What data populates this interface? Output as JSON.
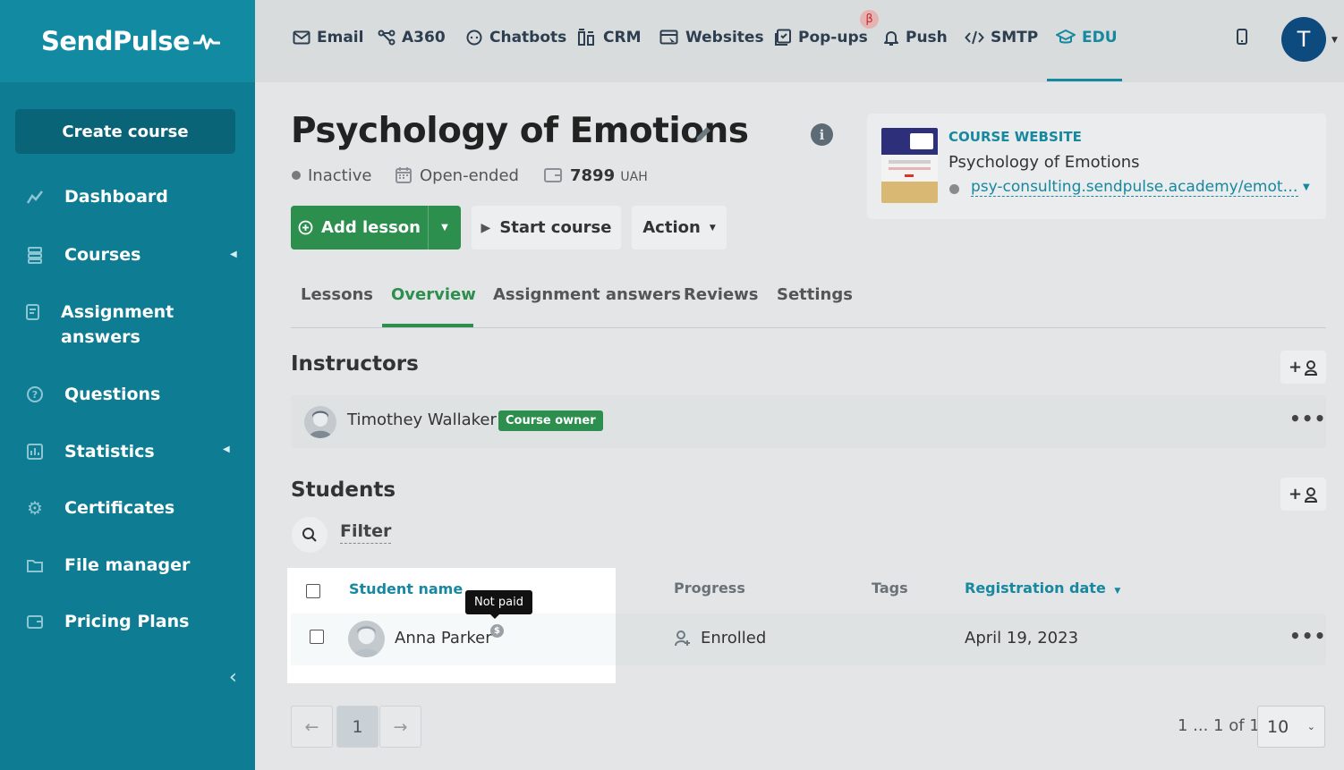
{
  "brand": "SendPulse",
  "sidebar": {
    "create_label": "Create course",
    "items": [
      {
        "label": "Dashboard",
        "icon": "chart-line-icon"
      },
      {
        "label": "Courses",
        "icon": "stack-icon"
      },
      {
        "label": "Assignment answers",
        "icon": "assignment-icon"
      },
      {
        "label": "Questions",
        "icon": "question-icon"
      },
      {
        "label": "Statistics",
        "icon": "statistics-icon"
      },
      {
        "label": "Certificates",
        "icon": "gear-icon"
      },
      {
        "label": "File manager",
        "icon": "folder-icon"
      },
      {
        "label": "Pricing Plans",
        "icon": "wallet-icon"
      }
    ]
  },
  "topnav": {
    "items": [
      {
        "label": "Email"
      },
      {
        "label": "A360"
      },
      {
        "label": "Chatbots"
      },
      {
        "label": "CRM"
      },
      {
        "label": "Websites"
      },
      {
        "label": "Pop-ups"
      },
      {
        "label": "Push"
      },
      {
        "label": "SMTP"
      },
      {
        "label": "EDU"
      }
    ],
    "beta": "β",
    "user_initial": "T"
  },
  "course": {
    "title": "Psychology of Emotions",
    "status": "Inactive",
    "duration": "Open-ended",
    "price": "7899",
    "currency": "UAH"
  },
  "actions": {
    "add_lesson": "Add lesson",
    "start_course": "Start course",
    "action": "Action"
  },
  "website": {
    "label": "COURSE WEBSITE",
    "name": "Psychology of Emotions",
    "url": "psy-consulting.sendpulse.academy/emoti..."
  },
  "tabs": [
    "Lessons",
    "Overview",
    "Assignment answers",
    "Reviews",
    "Settings"
  ],
  "instructors": {
    "title": "Instructors",
    "add_label": "+",
    "list": [
      {
        "name": "Timothey Wallaker",
        "badge": "Course owner"
      }
    ]
  },
  "students": {
    "title": "Students",
    "add_label": "+",
    "filter_label": "Filter",
    "columns": [
      "Student name",
      "Progress",
      "Tags",
      "Registration date"
    ],
    "rows": [
      {
        "name": "Anna Parker",
        "progress": "Enrolled",
        "tags": "",
        "registered": "April 19, 2023"
      }
    ],
    "tooltip": "Not paid",
    "coin": "$"
  },
  "pagination": {
    "prev": "←",
    "page": "1",
    "next": "→",
    "summary": "1 ... 1 of 1",
    "per_page": "10"
  },
  "colors": {
    "sidebar": "#0e7d93",
    "accent": "#16889f",
    "green": "#2c8f4d",
    "user_avatar": "#0d4a7e"
  }
}
